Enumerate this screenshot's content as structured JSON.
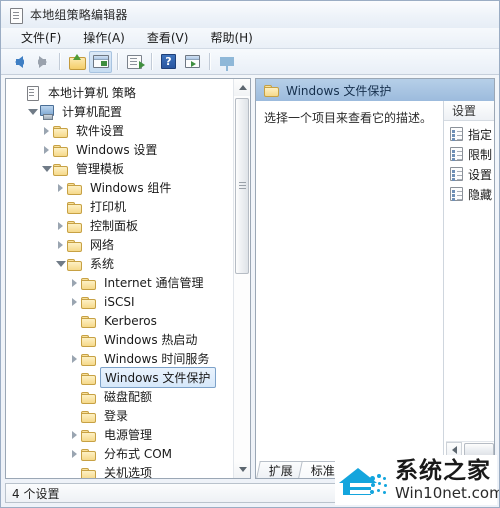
{
  "window": {
    "title": "本地组策略编辑器",
    "icon": "policy-document-icon"
  },
  "menubar": {
    "items": [
      {
        "label": "文件(F)",
        "name": "menu-file"
      },
      {
        "label": "操作(A)",
        "name": "menu-action"
      },
      {
        "label": "查看(V)",
        "name": "menu-view"
      },
      {
        "label": "帮助(H)",
        "name": "menu-help"
      }
    ]
  },
  "toolbar": {
    "buttons": [
      {
        "name": "back-button",
        "icon": "arrow-left-icon",
        "enabled": true
      },
      {
        "name": "forward-button",
        "icon": "arrow-right-icon",
        "enabled": false
      },
      {
        "name": "up-one-level-button",
        "icon": "folder-up-icon"
      },
      {
        "name": "show-hide-console-tree-button",
        "icon": "split-panes-icon",
        "pressed": true
      },
      {
        "name": "export-list-button",
        "icon": "export-list-icon"
      },
      {
        "name": "help-button",
        "icon": "help-question-icon"
      },
      {
        "name": "show-action-pane-button",
        "icon": "action-pane-icon"
      },
      {
        "name": "filter-button",
        "icon": "filter-funnel-icon"
      }
    ]
  },
  "tree": {
    "items": [
      {
        "label": "本地计算机 策略",
        "depth": 0,
        "icon": "policy-scroll-icon",
        "twisty": "none",
        "selected": false
      },
      {
        "label": "计算机配置",
        "depth": 1,
        "icon": "computer-icon",
        "twisty": "expanded",
        "selected": false
      },
      {
        "label": "软件设置",
        "depth": 2,
        "icon": "folder-icon",
        "twisty": "collapsed",
        "selected": false
      },
      {
        "label": "Windows 设置",
        "depth": 2,
        "icon": "folder-icon",
        "twisty": "collapsed",
        "selected": false
      },
      {
        "label": "管理模板",
        "depth": 2,
        "icon": "folder-icon",
        "twisty": "expanded",
        "selected": false
      },
      {
        "label": "Windows 组件",
        "depth": 3,
        "icon": "folder-icon",
        "twisty": "collapsed",
        "selected": false
      },
      {
        "label": "打印机",
        "depth": 3,
        "icon": "folder-icon",
        "twisty": "none",
        "selected": false
      },
      {
        "label": "控制面板",
        "depth": 3,
        "icon": "folder-icon",
        "twisty": "collapsed",
        "selected": false
      },
      {
        "label": "网络",
        "depth": 3,
        "icon": "folder-icon",
        "twisty": "collapsed",
        "selected": false
      },
      {
        "label": "系统",
        "depth": 3,
        "icon": "folder-icon",
        "twisty": "expanded",
        "selected": false
      },
      {
        "label": "Internet 通信管理",
        "depth": 4,
        "icon": "folder-icon",
        "twisty": "collapsed",
        "selected": false
      },
      {
        "label": "iSCSI",
        "depth": 4,
        "icon": "folder-icon",
        "twisty": "collapsed",
        "selected": false
      },
      {
        "label": "Kerberos",
        "depth": 4,
        "icon": "folder-icon",
        "twisty": "none",
        "selected": false
      },
      {
        "label": "Windows 热启动",
        "depth": 4,
        "icon": "folder-icon",
        "twisty": "none",
        "selected": false
      },
      {
        "label": "Windows 时间服务",
        "depth": 4,
        "icon": "folder-icon",
        "twisty": "collapsed",
        "selected": false
      },
      {
        "label": "Windows 文件保护",
        "depth": 4,
        "icon": "folder-icon",
        "twisty": "none",
        "selected": true
      },
      {
        "label": "磁盘配额",
        "depth": 4,
        "icon": "folder-icon",
        "twisty": "none",
        "selected": false
      },
      {
        "label": "登录",
        "depth": 4,
        "icon": "folder-icon",
        "twisty": "none",
        "selected": false
      },
      {
        "label": "电源管理",
        "depth": 4,
        "icon": "folder-icon",
        "twisty": "collapsed",
        "selected": false
      },
      {
        "label": "分布式 COM",
        "depth": 4,
        "icon": "folder-icon",
        "twisty": "collapsed",
        "selected": false
      },
      {
        "label": "关机选项",
        "depth": 4,
        "icon": "folder-icon",
        "twisty": "none",
        "selected": false
      }
    ]
  },
  "right_pane": {
    "header_title": "Windows 文件保护",
    "header_icon": "folder-icon",
    "description": "选择一个项目来查看它的描述。",
    "list_header": "设置",
    "list_items": [
      {
        "label": "指定",
        "icon": "policy-setting-icon"
      },
      {
        "label": "限制",
        "icon": "policy-setting-icon"
      },
      {
        "label": "设置",
        "icon": "policy-setting-icon"
      },
      {
        "label": "隐藏",
        "icon": "policy-setting-icon"
      }
    ],
    "tabs": [
      {
        "label": "扩展",
        "active": false,
        "name": "tab-extended"
      },
      {
        "label": "标准",
        "active": true,
        "name": "tab-standard"
      }
    ]
  },
  "statusbar": {
    "text": "4 个设置"
  },
  "watermark": {
    "cn": "系统之家",
    "en": "Win10net.com",
    "color": "#14a5dd"
  }
}
